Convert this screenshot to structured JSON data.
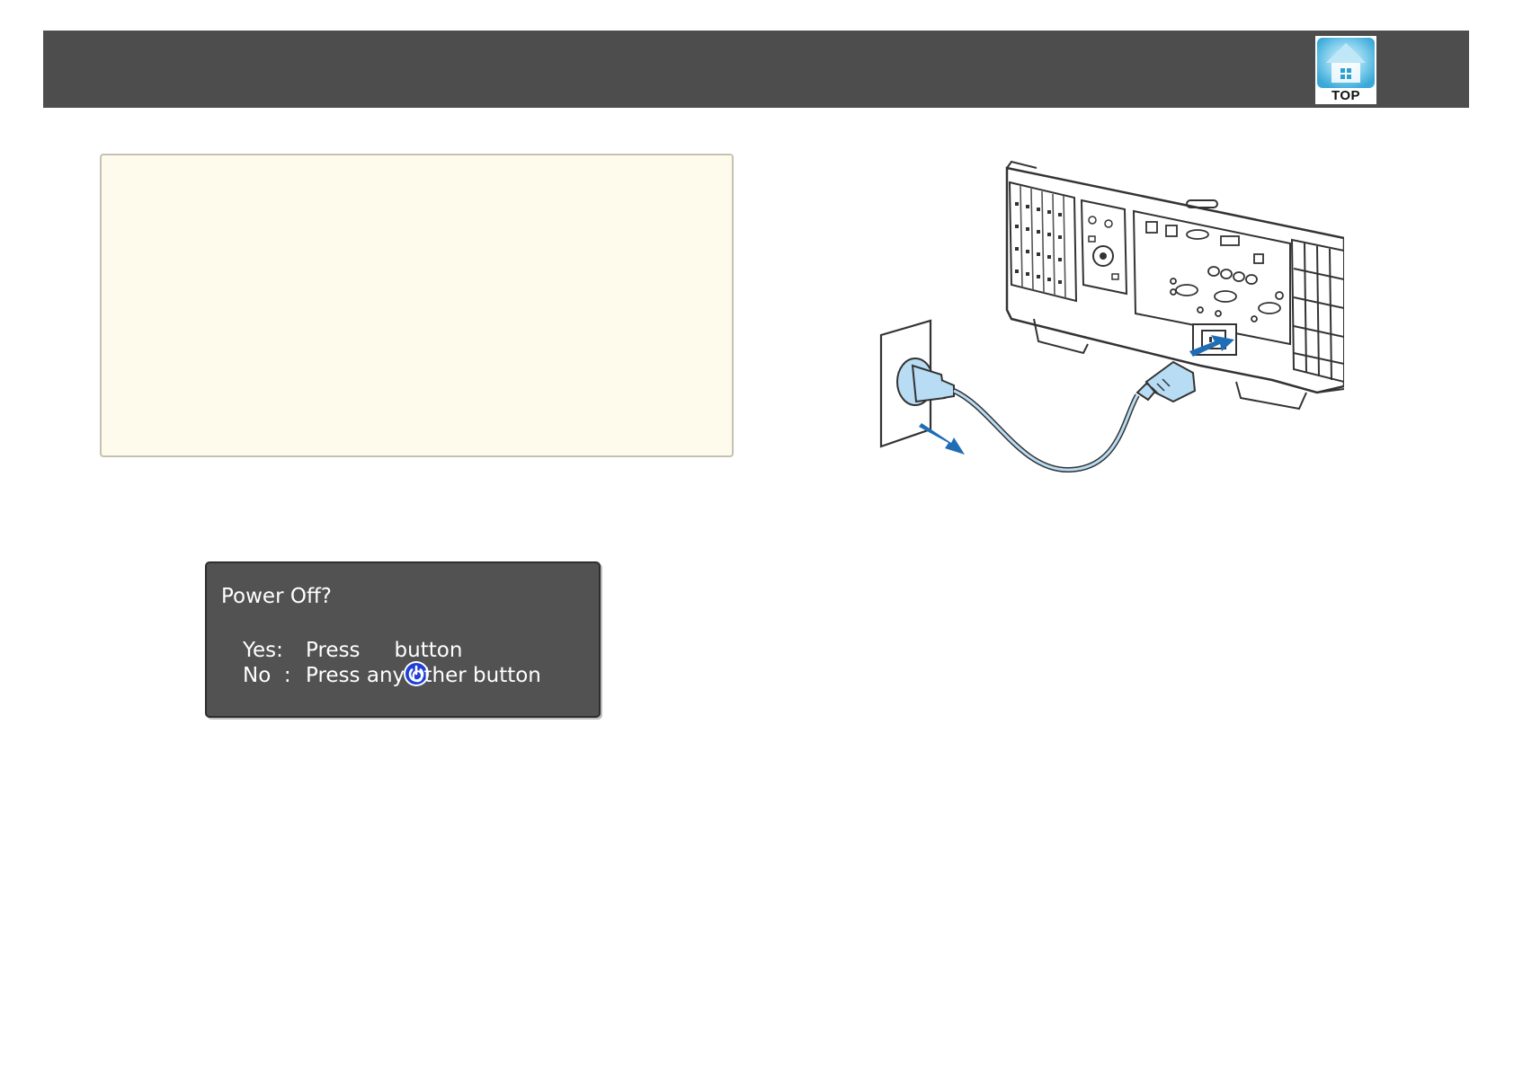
{
  "header": {
    "top_button_label": "TOP"
  },
  "note_box": {},
  "illustration": {
    "icon": "power-cord-unplug-illustration"
  },
  "dialog": {
    "title": "Power Off?",
    "yes_label": "Yes:",
    "yes_text_before": "Press",
    "yes_text_after": "button",
    "no_label": "No  :",
    "no_text": "Press any other button",
    "power_icon": "power-icon",
    "accent_color": "#1f3fd6"
  },
  "colors": {
    "header_bar": "#4d4d4d",
    "note_background": "#fefbec",
    "dialog_background": "#525252",
    "arrow_blue": "#1f6db5"
  }
}
